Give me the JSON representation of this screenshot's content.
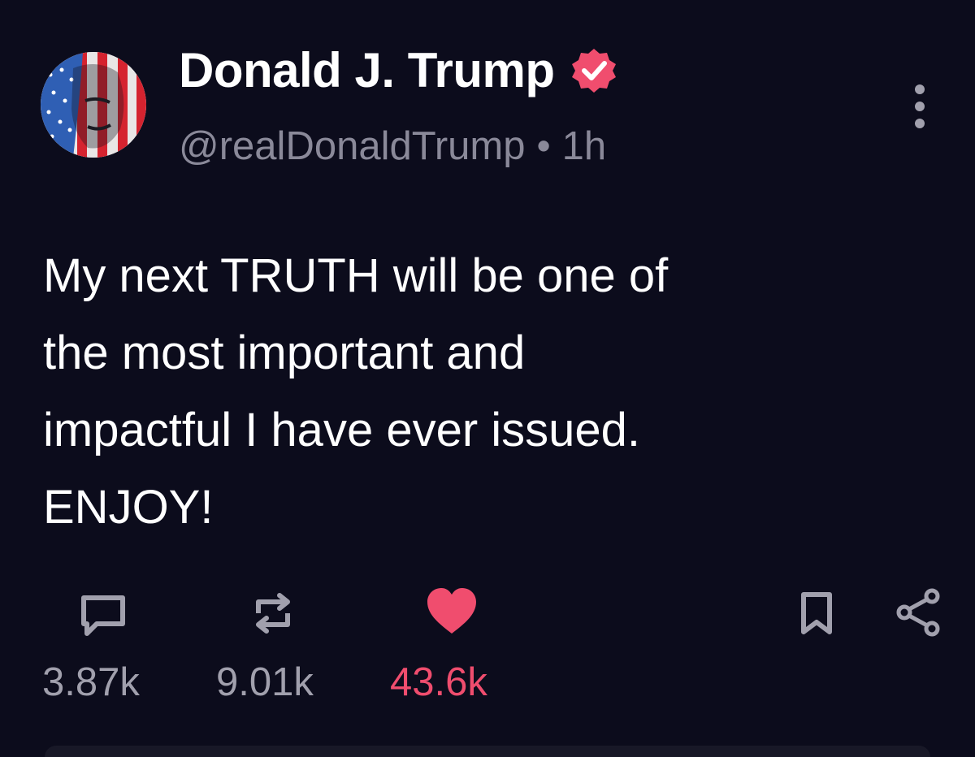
{
  "author": {
    "display_name": "Donald J. Trump",
    "handle": "@realDonaldTrump",
    "separator": "•",
    "timestamp": "1h",
    "verified": true,
    "verified_icon": "verified-badge-icon"
  },
  "post": {
    "lines": [
      "My next TRUTH will be one of",
      "the most important and",
      "impactful I have ever issued.",
      "ENJOY!"
    ]
  },
  "actions": {
    "reply_count": "3.87k",
    "retruth_count": "9.01k",
    "like_count": "43.6k",
    "liked": true
  },
  "colors": {
    "background": "#0c0c1c",
    "muted_text": "#8a8999",
    "accent_like": "#f04d6e",
    "verified_badge": "#f04d6e"
  },
  "icons": [
    "avatar",
    "verified-badge-icon",
    "more-vertical-icon",
    "reply-icon",
    "retruth-icon",
    "heart-icon",
    "bookmark-icon",
    "share-icon"
  ]
}
